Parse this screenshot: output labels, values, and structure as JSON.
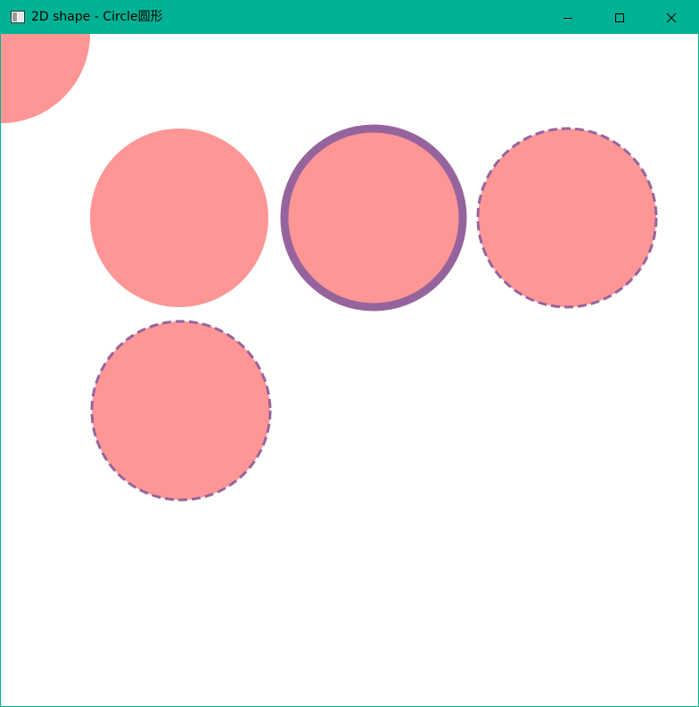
{
  "window": {
    "title": "2D shape - Circle圆形",
    "accent_color": "#00b294",
    "controls": {
      "minimize_icon": "minimize-icon",
      "maximize_icon": "maximize-icon",
      "close_icon": "close-icon"
    }
  },
  "canvas": {
    "background": "#ffffff",
    "fill_color": "#ff9696",
    "stroke_color": "#96649d",
    "circles": [
      {
        "name": "circle-clipped-corner",
        "style": "fill-only"
      },
      {
        "name": "circle-plain",
        "style": "fill-only"
      },
      {
        "name": "circle-thick-stroke",
        "style": "solid-stroke"
      },
      {
        "name": "circle-dashed-stroke",
        "style": "dashed-stroke"
      },
      {
        "name": "circle-dashed-stroke-2",
        "style": "dashed-stroke"
      }
    ]
  }
}
